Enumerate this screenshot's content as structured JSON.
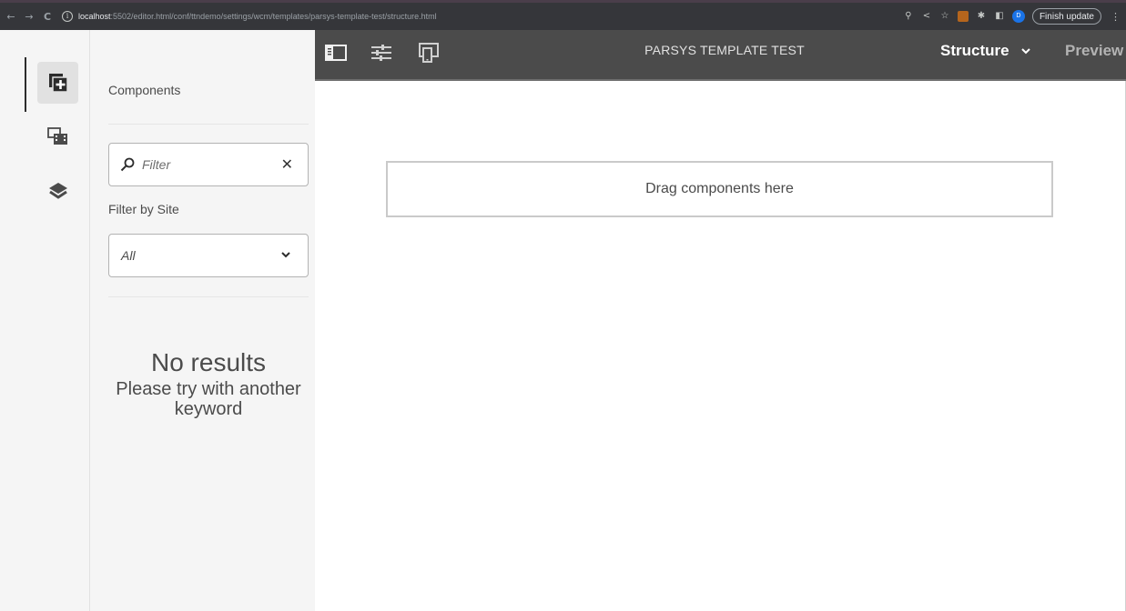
{
  "browser": {
    "back": "←",
    "forward": "→",
    "reload": "C",
    "url_host": "localhost",
    "url_path": ":5502/editor.html/conf/ttndemo/settings/wcm/templates/parsys-template-test/structure.html",
    "profile_initial": "D",
    "finish_update": "Finish update",
    "icons": [
      "zoom-icon",
      "share-icon",
      "bookmark-star-icon",
      "extension-icon",
      "puzzle-icon",
      "sidepanel-icon"
    ]
  },
  "rail": {
    "items": [
      {
        "name": "components",
        "icon": "add-component-icon",
        "active": true
      },
      {
        "name": "assets",
        "icon": "assets-icon",
        "active": false
      },
      {
        "name": "content-tree",
        "icon": "layers-icon",
        "active": false
      }
    ]
  },
  "panel": {
    "title": "Components",
    "filter_placeholder": "Filter",
    "filter_by_site_label": "Filter by Site",
    "site_value": "All",
    "no_results_title": "No results",
    "no_results_sub": "Please try with another keyword"
  },
  "header": {
    "page_title": "PARSYS TEMPLATE TEST",
    "mode": "Structure",
    "preview": "Preview"
  },
  "canvas": {
    "drop_zone": "Drag components here"
  }
}
